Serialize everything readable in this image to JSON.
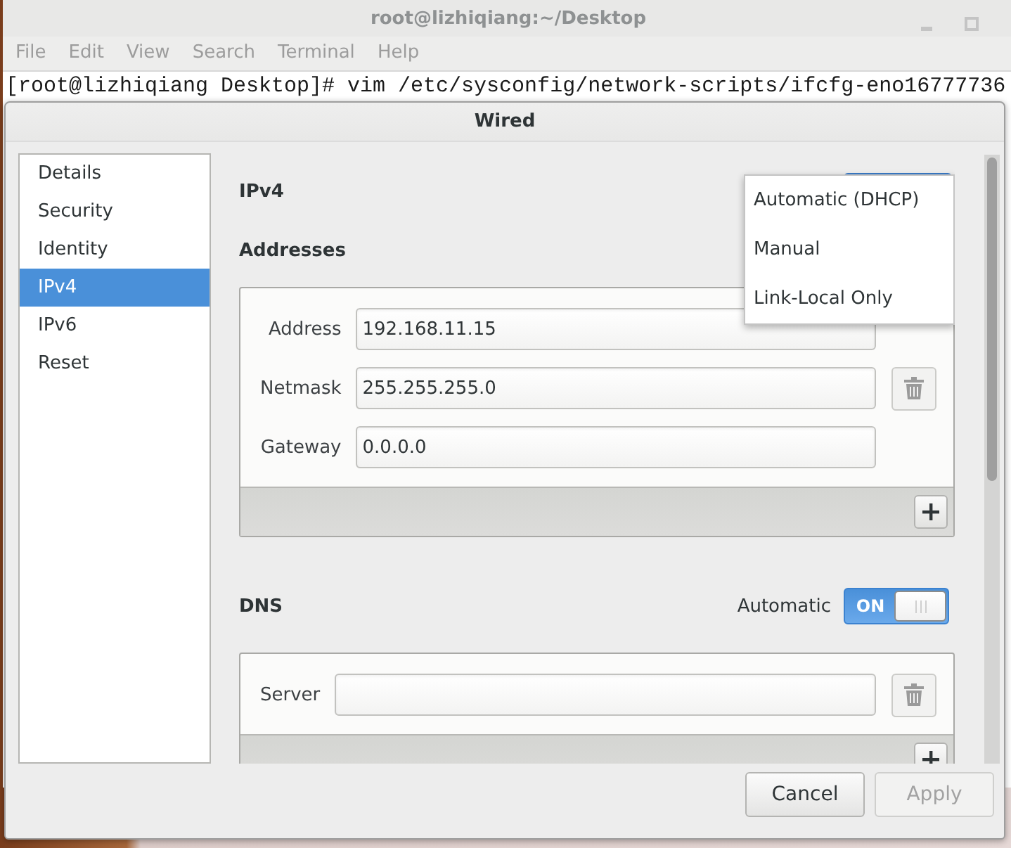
{
  "terminal": {
    "title": "root@lizhiqiang:~/Desktop",
    "menu": [
      "File",
      "Edit",
      "View",
      "Search",
      "Terminal",
      "Help"
    ],
    "lines": [
      "[root@lizhiqiang Desktop]# vim /etc/sysconfig/network-scripts/ifcfg-eno16777736"
    ]
  },
  "dialog": {
    "title": "Wired"
  },
  "sidebar": {
    "items": [
      {
        "label": "Details",
        "selected": false
      },
      {
        "label": "Security",
        "selected": false
      },
      {
        "label": "Identity",
        "selected": false
      },
      {
        "label": "IPv4",
        "selected": true
      },
      {
        "label": "IPv6",
        "selected": false
      },
      {
        "label": "Reset",
        "selected": false
      }
    ]
  },
  "ipv4": {
    "heading": "IPv4",
    "method_menu": [
      "Automatic (DHCP)",
      "Manual",
      "Link-Local Only"
    ]
  },
  "addresses": {
    "heading": "Addresses",
    "fields": [
      {
        "label": "Address",
        "value": "192.168.11.15"
      },
      {
        "label": "Netmask",
        "value": "255.255.255.0"
      },
      {
        "label": "Gateway",
        "value": "0.0.0.0"
      }
    ]
  },
  "dns": {
    "heading": "DNS",
    "automatic": {
      "label": "Automatic",
      "on": true,
      "switch_text": "ON"
    },
    "fields": [
      {
        "label": "Server"
      }
    ]
  },
  "buttons": [
    {
      "label": "Cancel",
      "disabled": false
    },
    {
      "label": "Apply",
      "disabled": true
    }
  ]
}
